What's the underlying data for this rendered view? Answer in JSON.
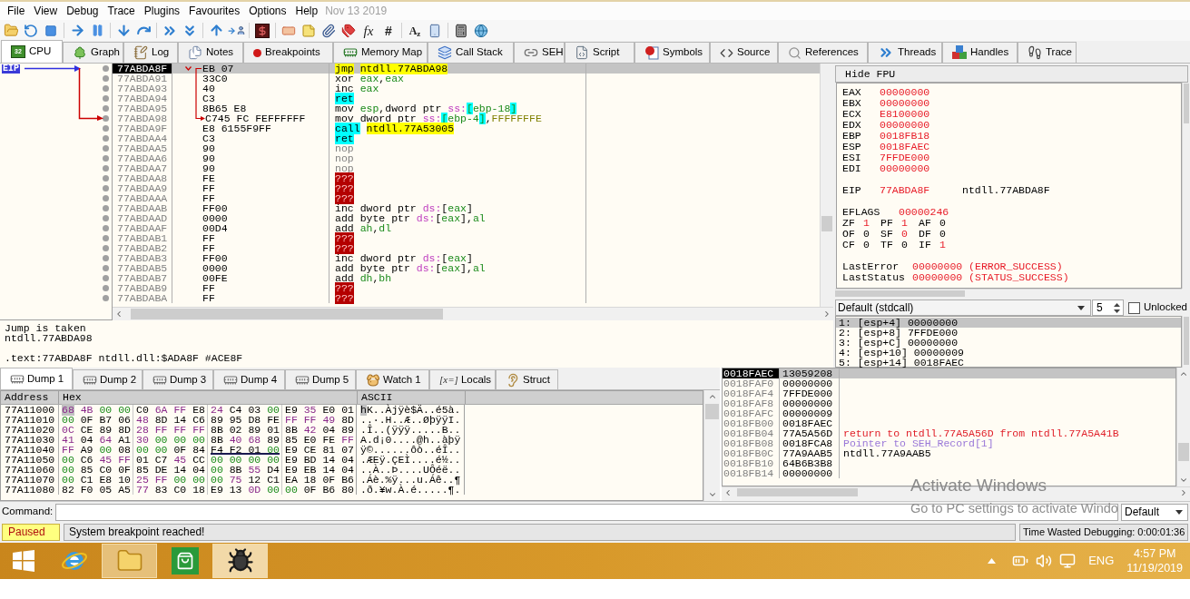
{
  "menu": {
    "items": [
      "File",
      "View",
      "Debug",
      "Trace",
      "Plugins",
      "Favourites",
      "Options",
      "Help"
    ],
    "build_date": "Nov 13 2019"
  },
  "toolbar": {
    "glyph_buttons": [
      "fx",
      "#",
      "A$_{z}$"
    ]
  },
  "tabs": [
    {
      "label": "CPU",
      "icon_label": "32",
      "selected": true
    },
    {
      "label": "Graph",
      "selected": false
    },
    {
      "label": "Log",
      "selected": false
    },
    {
      "label": "Notes",
      "selected": false
    },
    {
      "label": "Breakpoints",
      "selected": false
    },
    {
      "label": "Memory Map",
      "selected": false
    },
    {
      "label": "Call Stack",
      "selected": false
    },
    {
      "label": "SEH",
      "selected": false
    },
    {
      "label": "Script",
      "selected": false
    },
    {
      "label": "Symbols",
      "selected": false
    },
    {
      "label": "Source",
      "selected": false
    },
    {
      "label": "References",
      "selected": false
    },
    {
      "label": "Threads",
      "selected": false
    },
    {
      "label": "Handles",
      "selected": false
    },
    {
      "label": "Trace",
      "selected": false
    }
  ],
  "disassembly": {
    "eip_label": "EIP",
    "rows": [
      {
        "address": "77ABDA8F",
        "bytes": "EB 07",
        "mnemonic": {
          "text": "jmp",
          "kind": "jump"
        },
        "operands": [
          {
            "text": "ntdll.77ABDA98",
            "kind": "address"
          }
        ],
        "selected": true,
        "eip": true,
        "jump_start": true,
        "jump_end": false
      },
      {
        "address": "77ABDA91",
        "bytes": "33C0",
        "mnemonic": {
          "text": "xor",
          "kind": "plain"
        },
        "operands": [
          {
            "text": "eax",
            "kind": "register"
          },
          {
            "text": ",",
            "kind": "plain"
          },
          {
            "text": "eax",
            "kind": "register"
          }
        ],
        "selected": false,
        "eip": false,
        "jump_start": false,
        "jump_end": false
      },
      {
        "address": "77ABDA93",
        "bytes": "40",
        "mnemonic": {
          "text": "inc",
          "kind": "plain"
        },
        "operands": [
          {
            "text": "eax",
            "kind": "register"
          }
        ],
        "selected": false,
        "eip": false,
        "jump_start": false,
        "jump_end": false
      },
      {
        "address": "77ABDA94",
        "bytes": "C3",
        "mnemonic": {
          "text": "ret",
          "kind": "ret"
        },
        "selected": false,
        "eip": false,
        "jump_start": false,
        "jump_end": false
      },
      {
        "address": "77ABDA95",
        "bytes": "8B65 E8",
        "mnemonic": {
          "text": "mov",
          "kind": "plain"
        },
        "operands": [
          {
            "text": "esp",
            "kind": "register"
          },
          {
            "text": ",dword ptr",
            "kind": "plain"
          },
          {
            "text": " ss:",
            "kind": "segment"
          },
          {
            "text": "[",
            "kind": "mark"
          },
          {
            "text": "ebp-18",
            "kind": "register"
          },
          {
            "text": "]",
            "kind": "mark"
          }
        ],
        "selected": false,
        "eip": false,
        "jump_start": false,
        "jump_end": false
      },
      {
        "address": "77ABDA98",
        "bytes": "C745 FC FEFFFFFF",
        "mnemonic": {
          "text": "mov",
          "kind": "plain"
        },
        "operands": [
          {
            "text": "dword ptr",
            "kind": "plain"
          },
          {
            "text": " ss:",
            "kind": "segment"
          },
          {
            "text": "[",
            "kind": "mark"
          },
          {
            "text": "ebp-4",
            "kind": "register"
          },
          {
            "text": "]",
            "kind": "mark"
          },
          {
            "text": ",",
            "kind": "plain"
          },
          {
            "text": "FFFFFFFE",
            "kind": "value"
          }
        ],
        "selected": false,
        "eip": false,
        "jump_start": false,
        "jump_end": true
      },
      {
        "address": "77ABDA9F",
        "bytes": "E8 6155F9FF",
        "mnemonic": {
          "text": "call",
          "kind": "call"
        },
        "operands": [
          {
            "text": "ntdll.77A53005",
            "kind": "address"
          }
        ],
        "selected": false,
        "eip": false,
        "jump_start": false,
        "jump_end": false
      },
      {
        "address": "77ABDAA4",
        "bytes": "C3",
        "mnemonic": {
          "text": "ret",
          "kind": "ret"
        },
        "selected": false,
        "eip": false,
        "jump_start": false,
        "jump_end": false
      },
      {
        "address": "77ABDAA5",
        "bytes": "90",
        "mnemonic": {
          "text": "nop",
          "kind": "nop"
        },
        "selected": false,
        "eip": false,
        "jump_start": false,
        "jump_end": false
      },
      {
        "address": "77ABDAA6",
        "bytes": "90",
        "mnemonic": {
          "text": "nop",
          "kind": "nop"
        },
        "selected": false,
        "eip": false,
        "jump_start": false,
        "jump_end": false
      },
      {
        "address": "77ABDAA7",
        "bytes": "90",
        "mnemonic": {
          "text": "nop",
          "kind": "nop"
        },
        "selected": false,
        "eip": false,
        "jump_start": false,
        "jump_end": false
      },
      {
        "address": "77ABDAA8",
        "bytes": "FE",
        "mnemonic": {
          "text": "???",
          "kind": "invalid"
        },
        "selected": false,
        "eip": false,
        "jump_start": false,
        "jump_end": false
      },
      {
        "address": "77ABDAA9",
        "bytes": "FF",
        "mnemonic": {
          "text": "???",
          "kind": "invalid"
        },
        "selected": false,
        "eip": false,
        "jump_start": false,
        "jump_end": false
      },
      {
        "address": "77ABDAAA",
        "bytes": "FF",
        "mnemonic": {
          "text": "???",
          "kind": "invalid"
        },
        "selected": false,
        "eip": false,
        "jump_start": false,
        "jump_end": false
      },
      {
        "address": "77ABDAAB",
        "bytes": "FF00",
        "mnemonic": {
          "text": "inc",
          "kind": "plain"
        },
        "operands": [
          {
            "text": "dword ptr",
            "kind": "plain"
          },
          {
            "text": " ds:",
            "kind": "segment"
          },
          {
            "text": "[",
            "kind": "plain"
          },
          {
            "text": "eax",
            "kind": "register"
          },
          {
            "text": "]",
            "kind": "plain"
          }
        ],
        "selected": false,
        "eip": false,
        "jump_start": false,
        "jump_end": false
      },
      {
        "address": "77ABDAAD",
        "bytes": "0000",
        "mnemonic": {
          "text": "add",
          "kind": "plain"
        },
        "operands": [
          {
            "text": "byte ptr",
            "kind": "plain"
          },
          {
            "text": " ds:",
            "kind": "segment"
          },
          {
            "text": "[",
            "kind": "plain"
          },
          {
            "text": "eax",
            "kind": "register"
          },
          {
            "text": "],",
            "kind": "plain"
          },
          {
            "text": "al",
            "kind": "register"
          }
        ],
        "selected": false,
        "eip": false,
        "jump_start": false,
        "jump_end": false
      },
      {
        "address": "77ABDAAF",
        "bytes": "00D4",
        "mnemonic": {
          "text": "add",
          "kind": "plain"
        },
        "operands": [
          {
            "text": "ah",
            "kind": "register"
          },
          {
            "text": ",",
            "kind": "plain"
          },
          {
            "text": "dl",
            "kind": "register"
          }
        ],
        "selected": false,
        "eip": false,
        "jump_start": false,
        "jump_end": false
      },
      {
        "address": "77ABDAB1",
        "bytes": "FF",
        "mnemonic": {
          "text": "???",
          "kind": "invalid"
        },
        "selected": false,
        "eip": false,
        "jump_start": false,
        "jump_end": false
      },
      {
        "address": "77ABDAB2",
        "bytes": "FF",
        "mnemonic": {
          "text": "???",
          "kind": "invalid"
        },
        "selected": false,
        "eip": false,
        "jump_start": false,
        "jump_end": false
      },
      {
        "address": "77ABDAB3",
        "bytes": "FF00",
        "mnemonic": {
          "text": "inc",
          "kind": "plain"
        },
        "operands": [
          {
            "text": "dword ptr",
            "kind": "plain"
          },
          {
            "text": " ds:",
            "kind": "segment"
          },
          {
            "text": "[",
            "kind": "plain"
          },
          {
            "text": "eax",
            "kind": "register"
          },
          {
            "text": "]",
            "kind": "plain"
          }
        ],
        "selected": false,
        "eip": false,
        "jump_start": false,
        "jump_end": false
      },
      {
        "address": "77ABDAB5",
        "bytes": "0000",
        "mnemonic": {
          "text": "add",
          "kind": "plain"
        },
        "operands": [
          {
            "text": "byte ptr",
            "kind": "plain"
          },
          {
            "text": " ds:",
            "kind": "segment"
          },
          {
            "text": "[",
            "kind": "plain"
          },
          {
            "text": "eax",
            "kind": "register"
          },
          {
            "text": "],",
            "kind": "plain"
          },
          {
            "text": "al",
            "kind": "register"
          }
        ],
        "selected": false,
        "eip": false,
        "jump_start": false,
        "jump_end": false
      },
      {
        "address": "77ABDAB7",
        "bytes": "00FE",
        "mnemonic": {
          "text": "add",
          "kind": "plain"
        },
        "operands": [
          {
            "text": "dh",
            "kind": "register"
          },
          {
            "text": ",",
            "kind": "plain"
          },
          {
            "text": "bh",
            "kind": "register"
          }
        ],
        "selected": false,
        "eip": false,
        "jump_start": false,
        "jump_end": false
      },
      {
        "address": "77ABDAB9",
        "bytes": "FF",
        "mnemonic": {
          "text": "???",
          "kind": "invalid"
        },
        "selected": false,
        "eip": false,
        "jump_start": false,
        "jump_end": false
      },
      {
        "address": "77ABDABA",
        "bytes": "FF",
        "mnemonic": {
          "text": "???",
          "kind": "invalid"
        },
        "selected": false,
        "eip": false,
        "jump_start": false,
        "jump_end": false
      }
    ]
  },
  "info": {
    "lines": [
      "Jump is taken",
      "ntdll.77ABDA98"
    ],
    "location": ".text:77ABDA8F ntdll.dll:$ADA8F #ACE8F"
  },
  "registers": {
    "hide_fpu": "Hide FPU",
    "general": [
      {
        "name": "EAX",
        "value": "00000000",
        "modified": true
      },
      {
        "name": "EBX",
        "value": "00000000",
        "modified": true
      },
      {
        "name": "ECX",
        "value": "E8100000",
        "modified": true
      },
      {
        "name": "EDX",
        "value": "00000000",
        "modified": true
      },
      {
        "name": "EBP",
        "value": "0018FB18",
        "modified": true
      },
      {
        "name": "ESP",
        "value": "0018FAEC",
        "modified": true
      },
      {
        "name": "ESI",
        "value": "7FFDE000",
        "modified": true
      },
      {
        "name": "EDI",
        "value": "00000000",
        "modified": true
      }
    ],
    "eip": {
      "name": "EIP",
      "value": "77ABDA8F",
      "modified": true,
      "comment": "ntdll.77ABDA8F"
    },
    "eflags": {
      "name": "EFLAGS",
      "value": "00000246",
      "modified": true
    },
    "flag_rows": [
      {
        "flags": [
          {
            "name": "ZF",
            "value": "1",
            "modified": true
          },
          {
            "name": "PF",
            "value": "1",
            "modified": true
          },
          {
            "name": "AF",
            "value": "0",
            "modified": false
          }
        ]
      },
      {
        "flags": [
          {
            "name": "OF",
            "value": "0",
            "modified": false
          },
          {
            "name": "SF",
            "value": "0",
            "modified": true
          },
          {
            "name": "DF",
            "value": "0",
            "modified": false
          }
        ]
      },
      {
        "flags": [
          {
            "name": "CF",
            "value": "0",
            "modified": false
          },
          {
            "name": "TF",
            "value": "0",
            "modified": false
          },
          {
            "name": "IF",
            "value": "1",
            "modified": true
          }
        ]
      }
    ],
    "status": [
      {
        "name": "LastError",
        "value": "00000000 (ERROR_SUCCESS)",
        "modified": true
      },
      {
        "name": "LastStatus",
        "value": "00000000 (STATUS_SUCCESS)",
        "modified": true
      }
    ]
  },
  "call_args": {
    "convention": "Default (stdcall)",
    "count": "5",
    "unlocked_label": "Unlocked",
    "unlocked": false,
    "rows": [
      {
        "text": "1: [esp+4] 00000000",
        "selected": true
      },
      {
        "text": "2: [esp+8] 7FFDE000",
        "selected": false
      },
      {
        "text": "3: [esp+C] 00000000",
        "selected": false
      },
      {
        "text": "4: [esp+10] 00000009",
        "selected": false
      },
      {
        "text": "5: [esp+14] 0018FAEC",
        "selected": false
      }
    ]
  },
  "dump": {
    "tabs": [
      {
        "label": "Dump 1",
        "selected": true
      },
      {
        "label": "Dump 2",
        "selected": false
      },
      {
        "label": "Dump 3",
        "selected": false
      },
      {
        "label": "Dump 4",
        "selected": false
      },
      {
        "label": "Dump 5",
        "selected": false
      },
      {
        "label": "Watch 1",
        "selected": false
      },
      {
        "label": "Locals",
        "icon_label": "[x=]",
        "selected": false
      },
      {
        "label": "Struct",
        "selected": false
      }
    ],
    "columns": [
      "Address",
      "Hex",
      "ASCII"
    ],
    "rows": [
      {
        "address": "77A11000",
        "groups": [
          {
            "hex": "68 4B 00 00",
            "underlined": false
          },
          {
            "hex": "C0 6A FF E8",
            "underlined": false
          },
          {
            "hex": "24 C4 03 00",
            "underlined": false
          },
          {
            "hex": "E9 35 E0 01",
            "underlined": false
          }
        ],
        "ascii": "hK..Àjÿè$Ä..é5à.",
        "cursor": true
      },
      {
        "address": "77A11010",
        "groups": [
          {
            "hex": "00 0F B7 06",
            "underlined": false
          },
          {
            "hex": "48 8D 14 C6",
            "underlined": false
          },
          {
            "hex": "89 95 D8 FE",
            "underlined": false
          },
          {
            "hex": "FF FF 49 8D",
            "underlined": false
          }
        ],
        "ascii": "..·.H..Æ..ØþÿÿI.",
        "cursor": false
      },
      {
        "address": "77A11020",
        "groups": [
          {
            "hex": "0C CE 89 8D",
            "underlined": false
          },
          {
            "hex": "28 FF FF FF",
            "underlined": false
          },
          {
            "hex": "8B 02 89 01",
            "underlined": false
          },
          {
            "hex": "8B 42 04 89",
            "underlined": false
          }
        ],
        "ascii": ".Î..(ÿÿÿ.....B..",
        "cursor": false
      },
      {
        "address": "77A11030",
        "groups": [
          {
            "hex": "41 04 64 A1",
            "underlined": false
          },
          {
            "hex": "30 00 00 00",
            "underlined": false
          },
          {
            "hex": "8B 40 68 89",
            "underlined": false
          },
          {
            "hex": "85 E0 FE FF",
            "underlined": false
          }
        ],
        "ascii": "A.d¡0....@h..àþÿ",
        "cursor": false
      },
      {
        "address": "77A11040",
        "groups": [
          {
            "hex": "FF A9 00 08",
            "underlined": false
          },
          {
            "hex": "00 00 0F 84",
            "underlined": false
          },
          {
            "hex": "F4 F2 01 00",
            "underlined": true
          },
          {
            "hex": "E9 CE 81 07",
            "underlined": false
          }
        ],
        "ascii": "ÿ©......ôò..éÎ..",
        "cursor": false
      },
      {
        "address": "77A11050",
        "groups": [
          {
            "hex": "00 C6 45 FF",
            "underlined": false
          },
          {
            "hex": "01 C7 45 CC",
            "underlined": false
          },
          {
            "hex": "00 00 00 00",
            "underlined": false
          },
          {
            "hex": "E9 BD 14 04",
            "underlined": false
          }
        ],
        "ascii": ".ÆEÿ.ÇEÌ....é½..",
        "cursor": false
      },
      {
        "address": "77A11060",
        "groups": [
          {
            "hex": "00 85 C0 0F",
            "underlined": false
          },
          {
            "hex": "85 DE 14 04",
            "underlined": false
          },
          {
            "hex": "00 8B 55 D4",
            "underlined": false
          },
          {
            "hex": "E9 EB 14 04",
            "underlined": false
          }
        ],
        "ascii": "..À..Þ....UÔéë..",
        "cursor": false
      },
      {
        "address": "77A11070",
        "groups": [
          {
            "hex": "00 C1 E8 10",
            "underlined": false
          },
          {
            "hex": "25 FF 00 00",
            "underlined": false
          },
          {
            "hex": "00 75 12 C1",
            "underlined": false
          },
          {
            "hex": "EA 18 0F B6",
            "underlined": false
          }
        ],
        "ascii": ".Áè.%ÿ...u.Áê..¶",
        "cursor": false
      },
      {
        "address": "77A11080",
        "groups": [
          {
            "hex": "82 F0 05 A5",
            "underlined": false
          },
          {
            "hex": "77 83 C0 18",
            "underlined": false
          },
          {
            "hex": "E9 13 0D 00",
            "underlined": false
          },
          {
            "hex": "00 0F B6 80",
            "underlined": false
          }
        ],
        "ascii": ".ð.¥w.À.é.....¶.",
        "cursor": false
      }
    ]
  },
  "stack": {
    "rows": [
      {
        "address": "0018FAEC",
        "value": "13059208",
        "selected": true,
        "esp": true
      },
      {
        "address": "0018FAF0",
        "value": "00000000",
        "selected": false,
        "esp": false
      },
      {
        "address": "0018FAF4",
        "value": "7FFDE000",
        "selected": false,
        "esp": false
      },
      {
        "address": "0018FAF8",
        "value": "00000000",
        "selected": false,
        "esp": false
      },
      {
        "address": "0018FAFC",
        "value": "00000009",
        "selected": false,
        "esp": false
      },
      {
        "address": "0018FB00",
        "value": "0018FAEC",
        "selected": false,
        "esp": false
      },
      {
        "address": "0018FB04",
        "value": "77A5A56D",
        "comment": "return to ntdll.77A5A56D from ntdll.77A5A41B",
        "kind": "return",
        "selected": false,
        "esp": false
      },
      {
        "address": "0018FB08",
        "value": "0018FCA8",
        "comment": "Pointer to SEH_Record[1]",
        "kind": "seh",
        "selected": false,
        "esp": false
      },
      {
        "address": "0018FB0C",
        "value": "77A9AAB5",
        "comment": "ntdll.77A9AAB5",
        "kind": "module",
        "selected": false,
        "esp": false
      },
      {
        "address": "0018FB10",
        "value": "64B6B3B8",
        "selected": false,
        "esp": false
      },
      {
        "address": "0018FB14",
        "value": "00000000",
        "selected": false,
        "esp": false
      }
    ]
  },
  "command": {
    "label": "Command:",
    "mode": "Default"
  },
  "status": {
    "state": "Paused",
    "message": "System breakpoint reached!",
    "timer": "Time Wasted Debugging: 0:00:01:36"
  },
  "taskbar": {
    "apps": [
      {
        "running": false,
        "selected": false
      },
      {
        "running": true,
        "selected": false
      },
      {
        "running": false,
        "selected": false
      },
      {
        "running": true,
        "selected": true
      }
    ],
    "language": "ENG",
    "time": "4:57 PM",
    "date": "11/19/2019"
  },
  "activation_notice": {
    "title": "Activate Windows",
    "subtitle": "Go to PC settings to activate Windo"
  }
}
